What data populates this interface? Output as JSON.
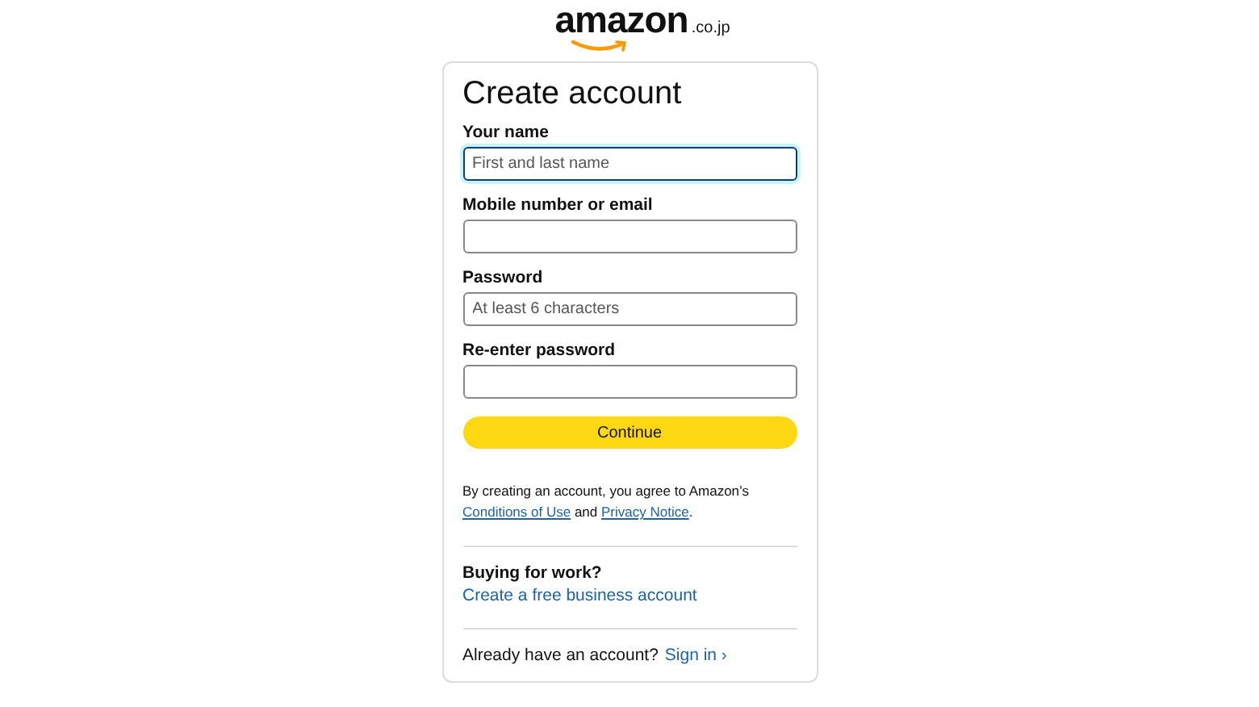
{
  "logo": {
    "wordmark": "amazon",
    "domain": ".co.jp"
  },
  "title": "Create account",
  "fields": [
    {
      "label": "Your name",
      "placeholder": "First and last name",
      "focused": true
    },
    {
      "label": "Mobile number or email",
      "focused": false
    },
    {
      "label": "Password",
      "placeholder": "At least 6 characters",
      "focused": false
    },
    {
      "label": "Re-enter password",
      "focused": false
    }
  ],
  "continue_button": "Continue",
  "agreement": [
    {
      "kind": "text",
      "text": "By creating an account, you agree to Amazon’s"
    },
    {
      "kind": "link",
      "text": "Conditions of Use"
    },
    {
      "kind": "text",
      "text": "and"
    },
    {
      "kind": "link",
      "text": "Privacy Notice"
    },
    {
      "kind": "text",
      "text": "."
    }
  ],
  "business": {
    "heading": "Buying for work?",
    "link": "Create a free business account"
  },
  "sign_in": {
    "prompt": "Already have an account?",
    "link": "Sign in",
    "chevron": "›"
  }
}
